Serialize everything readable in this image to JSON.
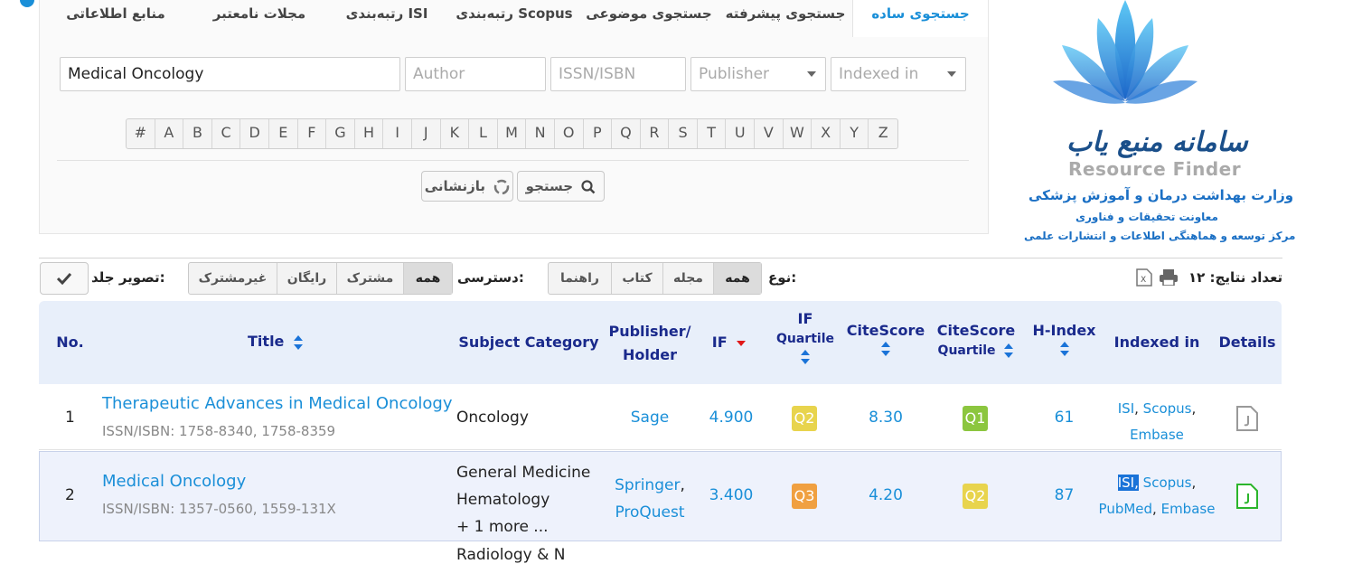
{
  "tabs": [
    "جستجوی ساده",
    "جستجوی پیشرفته",
    "جستجوی موضوعی",
    "رتبه‌بندی Scopus",
    "رتبه‌بندی ISI",
    "مجلات نامعتبر",
    "منابع اطلاعاتی"
  ],
  "search": {
    "title_value": "Medical Oncology",
    "author_placeholder": "Author",
    "issn_placeholder": "ISSN/ISBN",
    "publisher_selected": "Publisher",
    "indexed_selected": "Indexed in",
    "alphabet": [
      "#",
      "A",
      "B",
      "C",
      "D",
      "E",
      "F",
      "G",
      "H",
      "I",
      "J",
      "K",
      "L",
      "M",
      "N",
      "O",
      "P",
      "Q",
      "R",
      "S",
      "T",
      "U",
      "V",
      "W",
      "X",
      "Y",
      "Z"
    ],
    "search_label": "جستجو",
    "reset_label": "بازنشانی"
  },
  "logo": {
    "title": "سامانه منبع یاب",
    "subtitle": "Resource Finder",
    "line1": "وزارت بهداشت درمان و آموزش پزشکی",
    "line2": "معاونت تحقیقات و فناوری",
    "line3": "مرکز توسعه و هماهنگی اطلاعات و انتشارات علمی"
  },
  "filters": {
    "results_label": "تعداد نتایج: ۱۲",
    "type_label": "نوع:",
    "type_options": [
      "همه",
      "مجله",
      "کتاب",
      "راهنما"
    ],
    "access_label": "دسترسی:",
    "access_options": [
      "همه",
      "مشترک",
      "رایگان",
      "غیرمشترک"
    ],
    "cover_label": "تصویر جلد:"
  },
  "table": {
    "headers": {
      "no": "No.",
      "title": "Title",
      "subject": "Subject Category",
      "publisher1": "Publisher/",
      "publisher2": "Holder",
      "if": "IF",
      "ifq1": "IF",
      "ifq2": "Quartile",
      "citescore": "CiteScore",
      "csq1": "CiteScore",
      "csq2": "Quartile",
      "hindex": "H-Index",
      "indexed": "Indexed in",
      "details": "Details"
    },
    "rows": [
      {
        "no": "1",
        "title": "Therapeutic Advances in Medical Oncology",
        "issn": "ISSN/ISBN: 1758-8340, 1758-8359",
        "subject1": "Oncology",
        "publisher1": "Sage",
        "if": "4.900",
        "ifq": "Q2",
        "citescore": "8.30",
        "csq": "Q1",
        "hindex": "61",
        "idx1": "ISI",
        "idx2": "Scopus",
        "idx3": "Embase"
      },
      {
        "no": "2",
        "title": "Medical Oncology",
        "issn": "ISSN/ISBN: 1357-0560, 1559-131X",
        "subject1": "General Medicine",
        "subject2": "Hematology",
        "subject3": "+ 1 more ...",
        "publisher1": "Springer",
        "publisher2": "ProQuest",
        "if": "3.400",
        "ifq": "Q3",
        "citescore": "4.20",
        "csq": "Q2",
        "hindex": "87",
        "idx1": "ISI",
        "idx2": "Scopus",
        "idx3": "PubMed",
        "idx4": "Embase"
      }
    ],
    "row3_subject_partial": "Radiology & N"
  },
  "colors": {
    "accent": "#1a8fd8",
    "header_text": "#1a2a8c",
    "q1": "#8cc63f",
    "q2": "#e8d44d",
    "q3": "#f0a040"
  }
}
